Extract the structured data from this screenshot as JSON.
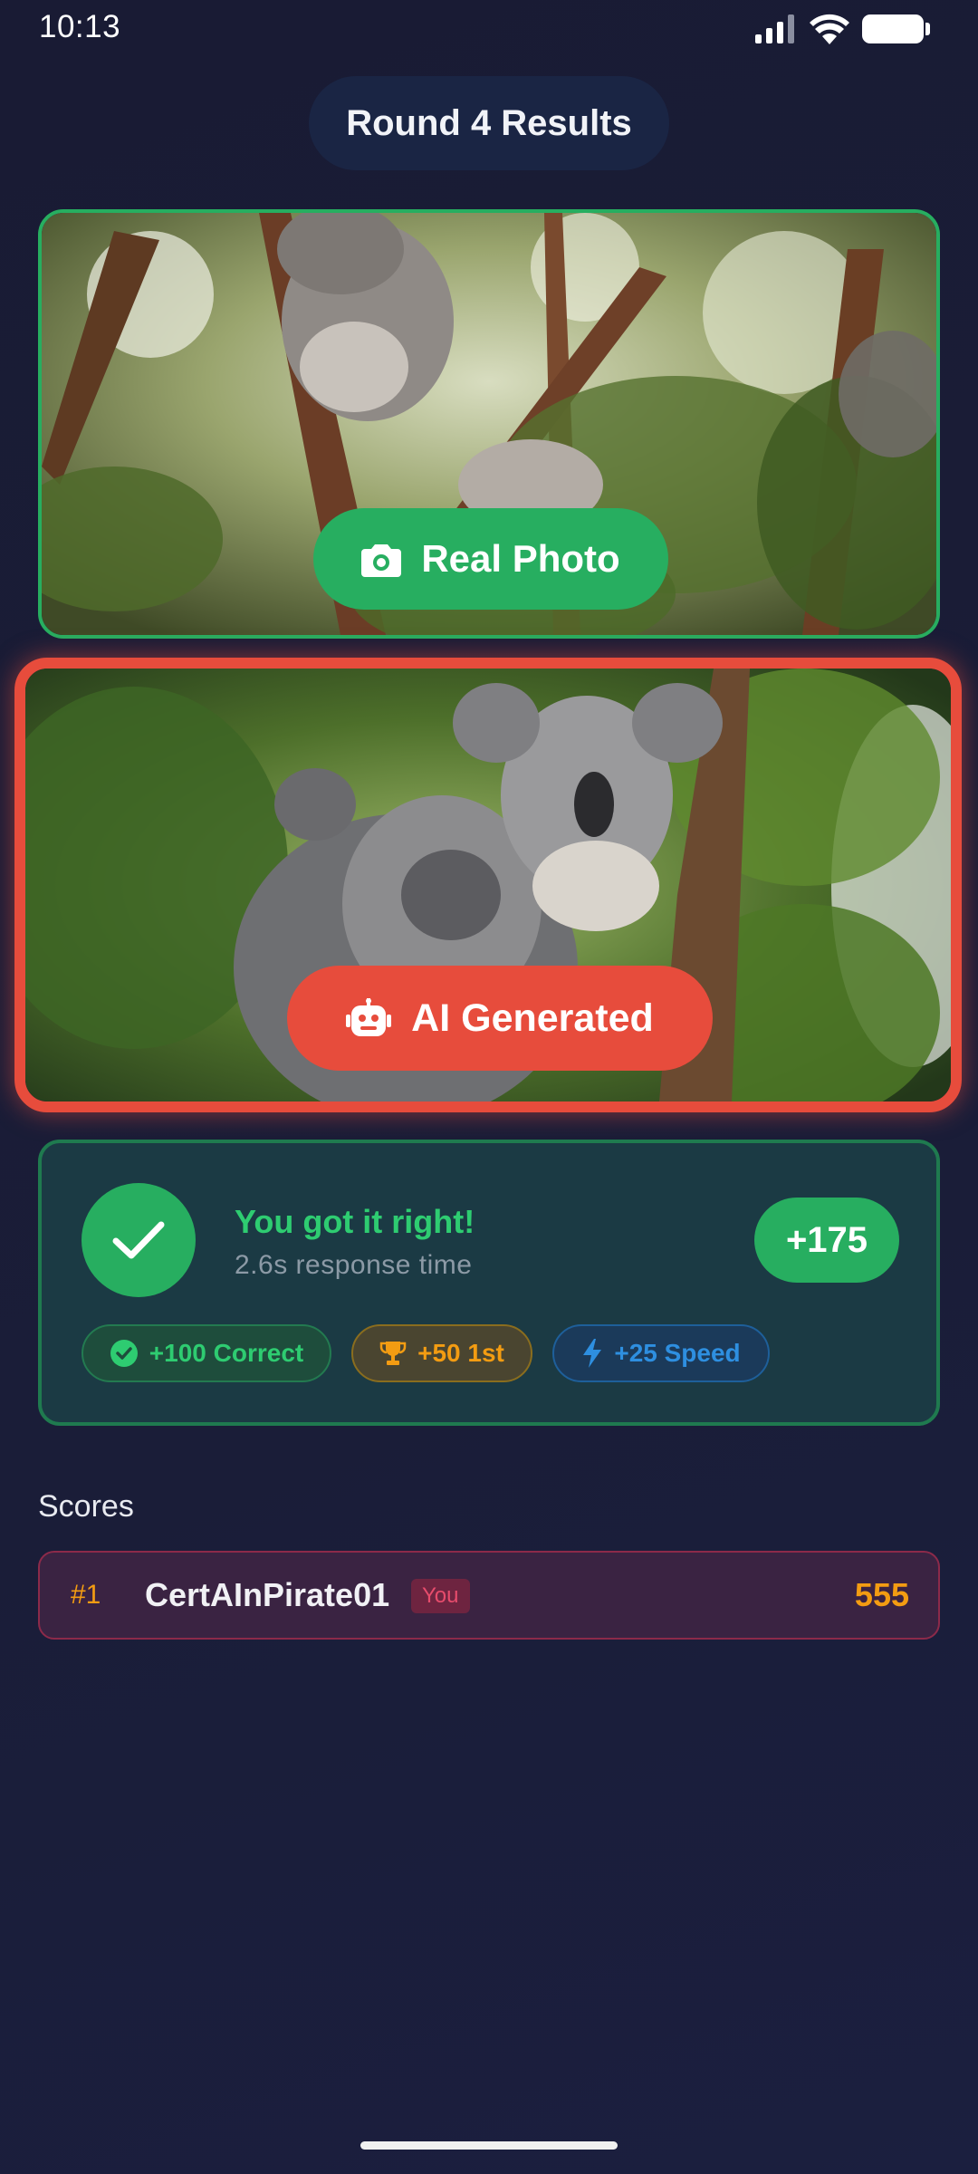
{
  "status_bar": {
    "time": "10:13"
  },
  "header": {
    "title": "Round 4 Results"
  },
  "images": [
    {
      "subject": "koala in eucalyptus tree",
      "label": "Real Photo",
      "icon": "camera-icon",
      "color": "#27ae60"
    },
    {
      "subject": "two koalas hugging on a tree",
      "label": "AI Generated",
      "icon": "robot-icon",
      "color": "#e74c3c",
      "selected": true
    }
  ],
  "result": {
    "title": "You got it right!",
    "subtitle": "2.6s response time",
    "points": "+175",
    "bonuses": [
      {
        "icon": "check-circle-icon",
        "label": "+100 Correct",
        "color": "#2ecc71"
      },
      {
        "icon": "trophy-icon",
        "label": "+50 1st",
        "color": "#f39c12"
      },
      {
        "icon": "lightning-icon",
        "label": "+25 Speed",
        "color": "#2e8fe0"
      }
    ]
  },
  "scores": {
    "heading": "Scores",
    "rows": [
      {
        "rank": "#1",
        "name": "CertAInPirate01",
        "badge": "You",
        "score": "555"
      }
    ]
  }
}
